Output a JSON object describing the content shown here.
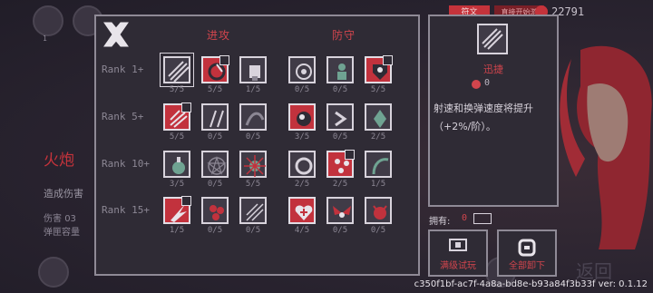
{
  "topbar": {
    "tab_active": "符文",
    "tab_second": "直接开始游",
    "currency": "22791"
  },
  "background": {
    "top_left_label": "1",
    "weapon_name": "火炮",
    "weapon_desc": "造成伤害",
    "stat1_label": "伤害",
    "stat1_value": "03",
    "stat2_label": "弹匣容量",
    "return_label": "返回"
  },
  "perk_panel": {
    "col_attack": "进攻",
    "col_defense": "防守",
    "rows": [
      {
        "label": "Rank 1+",
        "perks": [
          {
            "icon": "slash-icon",
            "count": "5/5",
            "red": false,
            "selected": true,
            "corner": false
          },
          {
            "icon": "swirl-icon",
            "count": "5/5",
            "red": true,
            "selected": false,
            "corner": true
          },
          {
            "icon": "fist-icon",
            "count": "1/5",
            "red": false,
            "selected": false,
            "corner": false
          },
          {
            "icon": "target-icon",
            "count": "0/5",
            "red": false,
            "selected": false,
            "corner": false
          },
          {
            "icon": "figure-icon",
            "count": "0/5",
            "red": false,
            "selected": false,
            "corner": false
          },
          {
            "icon": "eye-shield-icon",
            "count": "5/5",
            "red": true,
            "selected": false,
            "corner": true
          }
        ]
      },
      {
        "label": "Rank 5+",
        "perks": [
          {
            "icon": "claw-icon",
            "count": "5/5",
            "red": true,
            "selected": false,
            "corner": true
          },
          {
            "icon": "blades-icon",
            "count": "0/5",
            "red": false,
            "selected": false,
            "corner": false
          },
          {
            "icon": "wave-icon",
            "count": "0/5",
            "red": false,
            "selected": false,
            "corner": false
          },
          {
            "icon": "orb-icon",
            "count": "3/5",
            "red": true,
            "selected": false,
            "corner": false
          },
          {
            "icon": "chevron-icon",
            "count": "0/5",
            "red": false,
            "selected": false,
            "corner": false
          },
          {
            "icon": "crystal-icon",
            "count": "2/5",
            "red": false,
            "selected": false,
            "corner": false
          }
        ]
      },
      {
        "label": "Rank 10+",
        "perks": [
          {
            "icon": "potion-icon",
            "count": "3/5",
            "red": false,
            "selected": false,
            "corner": false
          },
          {
            "icon": "pentagram-icon",
            "count": "0/5",
            "red": false,
            "selected": false,
            "corner": false
          },
          {
            "icon": "burst-icon",
            "count": "5/5",
            "red": false,
            "selected": false,
            "corner": false
          },
          {
            "icon": "ring-icon",
            "count": "2/5",
            "red": false,
            "selected": false,
            "corner": false
          },
          {
            "icon": "hearts-icon",
            "count": "2/5",
            "red": true,
            "selected": false,
            "corner": true
          },
          {
            "icon": "scythe-icon",
            "count": "1/5",
            "red": false,
            "selected": false,
            "corner": false
          }
        ]
      },
      {
        "label": "Rank 15+",
        "perks": [
          {
            "icon": "flame-icon",
            "count": "1/5",
            "red": true,
            "selected": false,
            "corner": true
          },
          {
            "icon": "cluster-icon",
            "count": "0/5",
            "red": false,
            "selected": false,
            "corner": false
          },
          {
            "icon": "arrows-icon",
            "count": "0/5",
            "red": false,
            "selected": false,
            "corner": false
          },
          {
            "icon": "heart-cross-icon",
            "count": "4/5",
            "red": true,
            "selected": false,
            "corner": false
          },
          {
            "icon": "wings-icon",
            "count": "0/5",
            "red": false,
            "selected": false,
            "corner": false
          },
          {
            "icon": "demon-icon",
            "count": "0/5",
            "red": false,
            "selected": false,
            "corner": false
          }
        ]
      }
    ]
  },
  "detail": {
    "name": "迅捷",
    "cost": "0",
    "description": "射速和换弹速度将提升（+2%/阶）。"
  },
  "owned": {
    "label": "拥有:",
    "count": "0"
  },
  "buttons": {
    "max_trial": "满级试玩",
    "unequip_all": "全部卸下"
  },
  "version": "c350f1bf-ac7f-4a8a-bd8e-b93a84f3b33f ver: 0.1.12",
  "colors": {
    "accent_red": "#c2323d",
    "panel_bg": "#2f2b35",
    "border": "#8f8a96"
  }
}
